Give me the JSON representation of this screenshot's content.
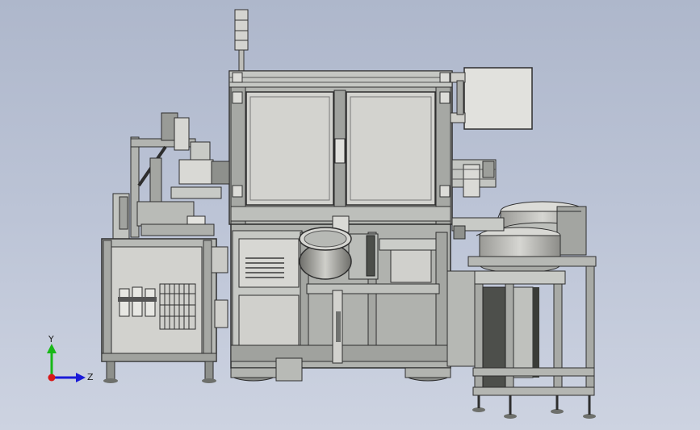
{
  "triad": {
    "x_label": "",
    "y_label": "Y",
    "z_label": "Z",
    "y_color": "#18b818",
    "z_color": "#1a1ad8",
    "x_color": "#d81818"
  },
  "colors": {
    "background_top": "#aeb7cb",
    "panel": "#c9c9c2",
    "frame": "#a9aba6",
    "dark": "#4a4a4a"
  }
}
